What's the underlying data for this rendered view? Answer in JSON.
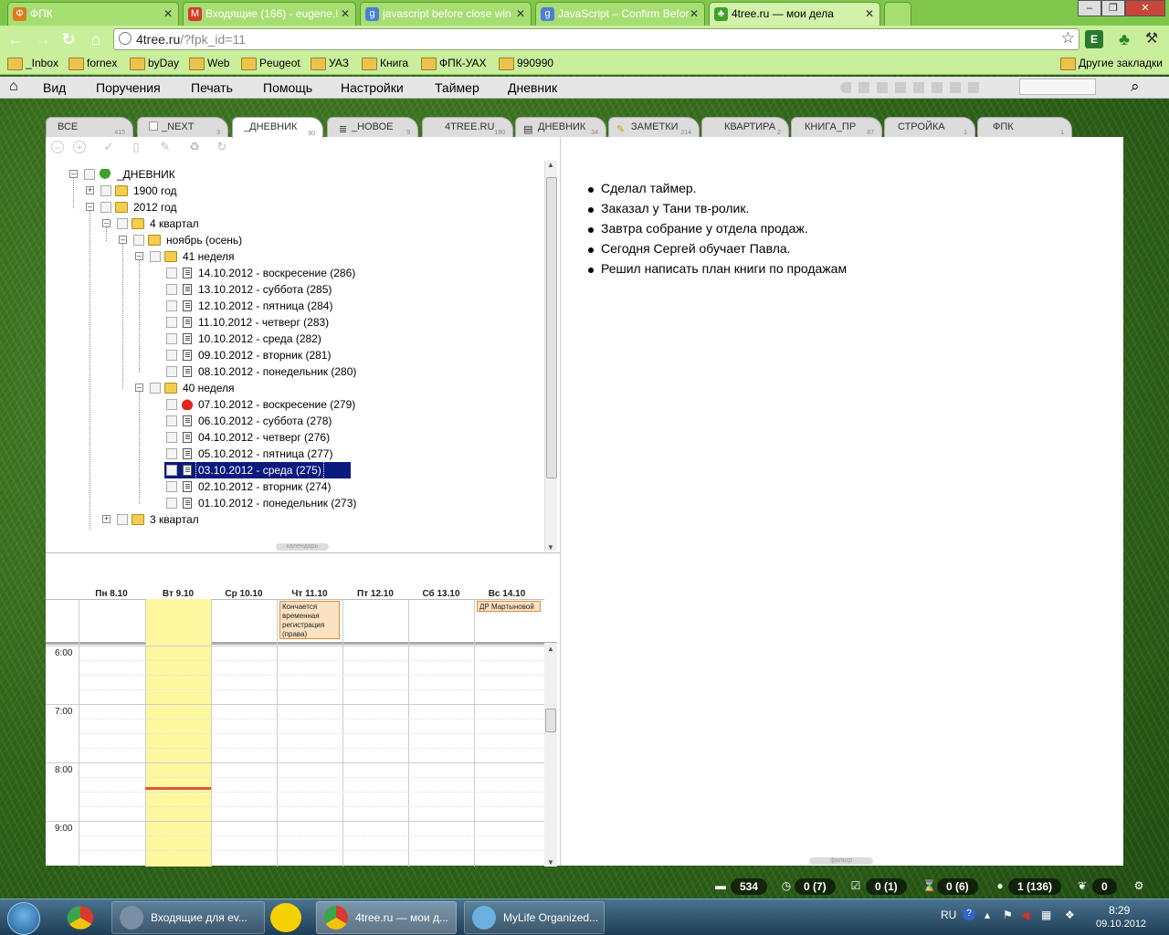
{
  "browser": {
    "tabs": [
      {
        "label": "ФПК",
        "color": "#e07a1a"
      },
      {
        "label": "Входящие (166) - eugene.l",
        "color": "#d83a2a"
      },
      {
        "label": "javascript before close win",
        "color": "#4a7fd8"
      },
      {
        "label": "JavaScript – Confirm Befor",
        "color": "#4a7fd8"
      },
      {
        "label": "4tree.ru — мои дела",
        "color": "#3da32a"
      }
    ],
    "url_host": "4tree.ru",
    "url_path": "/?fpk_id=11",
    "bookmarks": [
      "_Inbox",
      "fornex",
      "byDay",
      "Web",
      "Peugeot",
      "УАЗ",
      "Книга",
      "ФПК-УАХ",
      "990990"
    ],
    "other_bookmarks": "Другие закладки"
  },
  "menu": {
    "items": [
      "Вид",
      "Поручения",
      "Печать",
      "Помощь",
      "Настройки",
      "Таймер",
      "Дневник"
    ]
  },
  "tabs": [
    {
      "label": "ВСЕ",
      "count": "415"
    },
    {
      "label": "_NEXT",
      "count": "3"
    },
    {
      "label": "_ДНЕВНИК",
      "count": "90"
    },
    {
      "label": "_НОВОЕ",
      "count": "9"
    },
    {
      "label": "4TREE.RU",
      "count": "190"
    },
    {
      "label": "ДНЕВНИК",
      "count": "34"
    },
    {
      "label": "ЗАМЕТКИ",
      "count": "214"
    },
    {
      "label": "КВАРТИРА",
      "count": "2"
    },
    {
      "label": "КНИГА_ПР",
      "count": "87"
    },
    {
      "label": "СТРОЙКА",
      "count": "1"
    },
    {
      "label": "ФПК",
      "count": "1"
    }
  ],
  "tree": {
    "root": "_ДНЕВНИК",
    "y1900": "1900 год",
    "y2012": "2012 год",
    "q4": "4 квартал",
    "nov": "ноябрь (осень)",
    "w41": "41 неделя",
    "w41_days": [
      "14.10.2012 - воскресение (286)",
      "13.10.2012 - суббота (285)",
      "12.10.2012 - пятница (284)",
      "11.10.2012 - четверг (283)",
      "10.10.2012 - среда (282)",
      "09.10.2012 - вторник (281)",
      "08.10.2012 - понедельник (280)"
    ],
    "w40": "40 неделя",
    "w40_days": [
      "07.10.2012 - воскресение (279)",
      "06.10.2012 - суббота (278)",
      "04.10.2012 - четверг (276)",
      "05.10.2012 - пятница (277)",
      "03.10.2012 - среда (275)",
      "02.10.2012 - вторник (274)",
      "01.10.2012 - понедельник (273)"
    ],
    "q3": "3 квартал",
    "handle": "календарь"
  },
  "calendar": {
    "days": [
      "Пн 8.10",
      "Вт 9.10",
      "Ср 10.10",
      "Чт 11.10",
      "Пт 12.10",
      "Сб 13.10",
      "Вс 14.10"
    ],
    "events": [
      {
        "day": 3,
        "text": "Кончается временная регистрация (права)"
      },
      {
        "day": 6,
        "text": "ДР Мартыновой"
      }
    ],
    "hours": [
      "6:00",
      "7:00",
      "8:00",
      "9:00"
    ]
  },
  "notes": [
    "Сделал таймер.",
    "Заказал у Тани тв-ролик.",
    "Завтра собрание у отдела продаж.",
    "Сегодня Сергей обучает Павла.",
    "Решил написать план книги по продажам"
  ],
  "notes_handle": "фильтр",
  "status": {
    "folders": "534",
    "timers": "0 (7)",
    "done": "0 (1)",
    "waiting": "0 (6)",
    "active": "1 (136)",
    "leaf": "0"
  },
  "taskbar": {
    "items": [
      "Входящие для ev...",
      "4tree.ru — мои д...",
      "MyLife Organized..."
    ],
    "lang": "RU",
    "time": "8:29",
    "date": "09.10.2012"
  }
}
